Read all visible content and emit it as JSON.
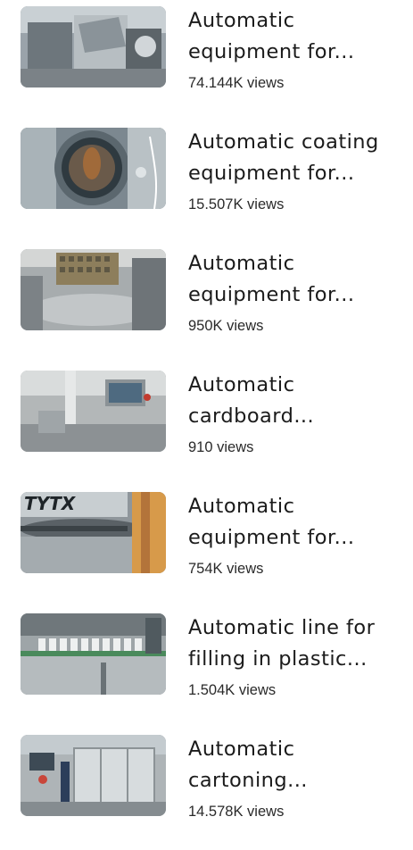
{
  "videos": [
    {
      "title_line1": "Automatic",
      "title_line2": "equipment for...",
      "views": "74.144K views"
    },
    {
      "title_line1": "Automatic coating",
      "title_line2": "equipment for...",
      "views": "15.507K views"
    },
    {
      "title_line1": "Automatic",
      "title_line2": "equipment for...",
      "views": "950K views"
    },
    {
      "title_line1": "Automatic",
      "title_line2": "cardboard...",
      "views": "910 views"
    },
    {
      "title_line1": "Automatic",
      "title_line2": "equipment for...",
      "views": "754K views"
    },
    {
      "title_line1": "Automatic line for",
      "title_line2": "filling in plastic...",
      "views": "1.504K views"
    },
    {
      "title_line1": "Automatic",
      "title_line2": "cartoning...",
      "views": "14.578K views"
    }
  ],
  "thumbnail_logo_text": "TYTX"
}
